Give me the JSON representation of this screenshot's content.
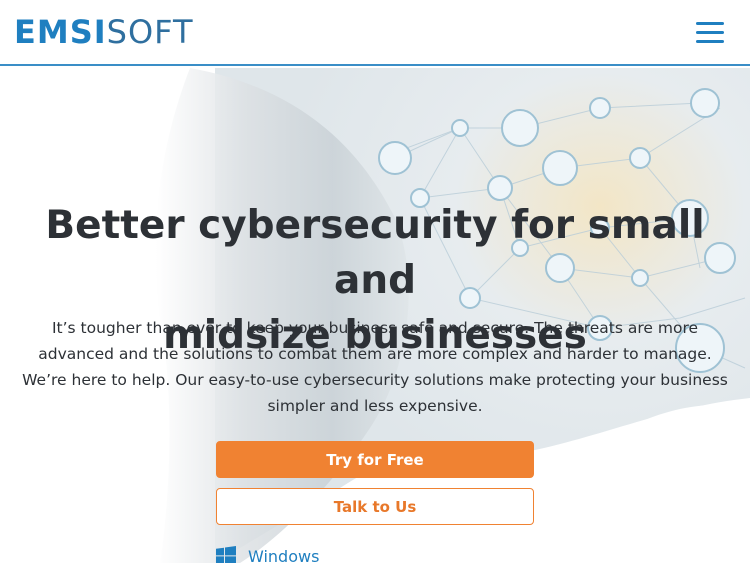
{
  "header": {
    "logo_part1": "EMSI",
    "logo_part2": "SOFT",
    "menu_icon": "hamburger-menu-icon"
  },
  "hero": {
    "headline_line1": "Better cybersecurity for small and",
    "headline_line2": "midsize businesses",
    "subtext": "It’s tougher than ever to keep your business safe and secure. The threats are more advanced and the solutions to combat them are more complex and harder to manage. We’re here to help. Our easy-to-use cybersecurity solutions make protecting your business simpler and less expensive.",
    "primary_button": "Try for Free",
    "secondary_button": "Talk to Us",
    "platform_label": "Windows",
    "platform_icon": "windows-logo-icon"
  },
  "colors": {
    "brand_blue": "#1f7fc0",
    "accent_orange": "#f08232",
    "text_dark": "#2d3136"
  }
}
